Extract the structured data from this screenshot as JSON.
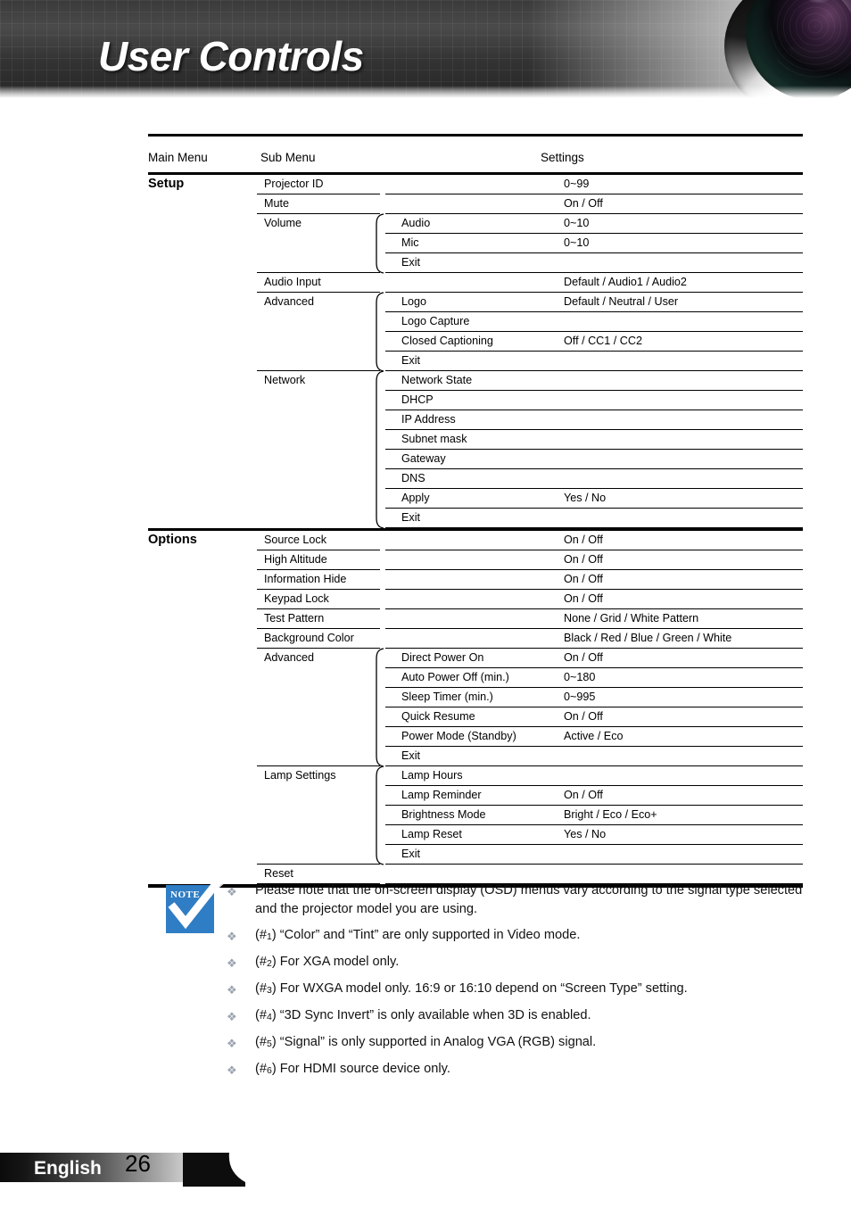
{
  "header": {
    "title": "User Controls",
    "lens_icon": "camera-lens-icon"
  },
  "table": {
    "columns": {
      "main": "Main Menu",
      "sub": "Sub Menu",
      "settings": "Settings"
    },
    "sections": [
      {
        "main": "Setup",
        "rows": [
          {
            "sub": "Projector ID",
            "sub2": "",
            "value": "0~99"
          },
          {
            "sub": "Mute",
            "sub2": "",
            "value": "On / Off"
          },
          {
            "sub": "Volume",
            "sub2": "Audio",
            "value": "0~10"
          },
          {
            "sub": "",
            "sub2": "Mic",
            "value": "0~10"
          },
          {
            "sub": "",
            "sub2": "Exit",
            "value": ""
          },
          {
            "sub": "Audio Input",
            "sub2": "",
            "value": "Default / Audio1 / Audio2"
          },
          {
            "sub": "Advanced",
            "sub2": "Logo",
            "value": "Default / Neutral / User"
          },
          {
            "sub": "",
            "sub2": "Logo Capture",
            "value": ""
          },
          {
            "sub": "",
            "sub2": "Closed Captioning",
            "value": "Off / CC1 / CC2"
          },
          {
            "sub": "",
            "sub2": "Exit",
            "value": ""
          },
          {
            "sub": "Network",
            "sub2": "Network State",
            "value": ""
          },
          {
            "sub": "",
            "sub2": "DHCP",
            "value": ""
          },
          {
            "sub": "",
            "sub2": "IP Address",
            "value": ""
          },
          {
            "sub": "",
            "sub2": "Subnet mask",
            "value": ""
          },
          {
            "sub": "",
            "sub2": "Gateway",
            "value": ""
          },
          {
            "sub": "",
            "sub2": "DNS",
            "value": ""
          },
          {
            "sub": "",
            "sub2": "Apply",
            "value": "Yes / No"
          },
          {
            "sub": "",
            "sub2": "Exit",
            "value": ""
          }
        ]
      },
      {
        "main": "Options",
        "rows": [
          {
            "sub": "Source Lock",
            "sub2": "",
            "value": "On / Off"
          },
          {
            "sub": "High Altitude",
            "sub2": "",
            "value": "On / Off"
          },
          {
            "sub": "Information Hide",
            "sub2": "",
            "value": "On / Off"
          },
          {
            "sub": "Keypad Lock",
            "sub2": "",
            "value": "On / Off"
          },
          {
            "sub": "Test Pattern",
            "sub2": "",
            "value": "None / Grid / White Pattern"
          },
          {
            "sub": "Background Color",
            "sub2": "",
            "value": "Black / Red / Blue / Green / White"
          },
          {
            "sub": "Advanced",
            "sub2": "Direct Power On",
            "value": "On / Off"
          },
          {
            "sub": "",
            "sub2": "Auto Power Off (min.)",
            "value": "0~180"
          },
          {
            "sub": "",
            "sub2": "Sleep Timer (min.)",
            "value": "0~995"
          },
          {
            "sub": "",
            "sub2": "Quick Resume",
            "value": "On / Off"
          },
          {
            "sub": "",
            "sub2": "Power Mode (Standby)",
            "value": "Active / Eco"
          },
          {
            "sub": "",
            "sub2": "Exit",
            "value": ""
          },
          {
            "sub": "Lamp Settings",
            "sub2": "Lamp Hours",
            "value": ""
          },
          {
            "sub": "",
            "sub2": "Lamp Reminder",
            "value": "On / Off"
          },
          {
            "sub": "",
            "sub2": "Brightness Mode",
            "value": "Bright / Eco / Eco+"
          },
          {
            "sub": "",
            "sub2": "Lamp Reset",
            "value": "Yes / No"
          },
          {
            "sub": "",
            "sub2": "Exit",
            "value": ""
          },
          {
            "sub": "Reset",
            "sub2": "",
            "value": ""
          }
        ]
      }
    ]
  },
  "notes": {
    "icon_label": "NOTE",
    "icon_color": "#2f7dc4",
    "bullet_glyph": "❖",
    "items": [
      "Please note that the on-screen display (OSD) menus vary according to the signal type selected and the projector model you are using.",
      "(#1) “Color” and “Tint” are only supported in Video mode.",
      "(#2) For XGA model only.",
      "(#3) For WXGA model only. 16:9 or 16:10 depend on “Screen Type” setting.",
      "(#4) “3D Sync Invert” is only available when 3D is enabled.",
      "(#5) “Signal” is only supported in Analog VGA (RGB) signal.",
      "(#6) For HDMI source device only."
    ]
  },
  "footer": {
    "language": "English",
    "page_number": "26"
  }
}
